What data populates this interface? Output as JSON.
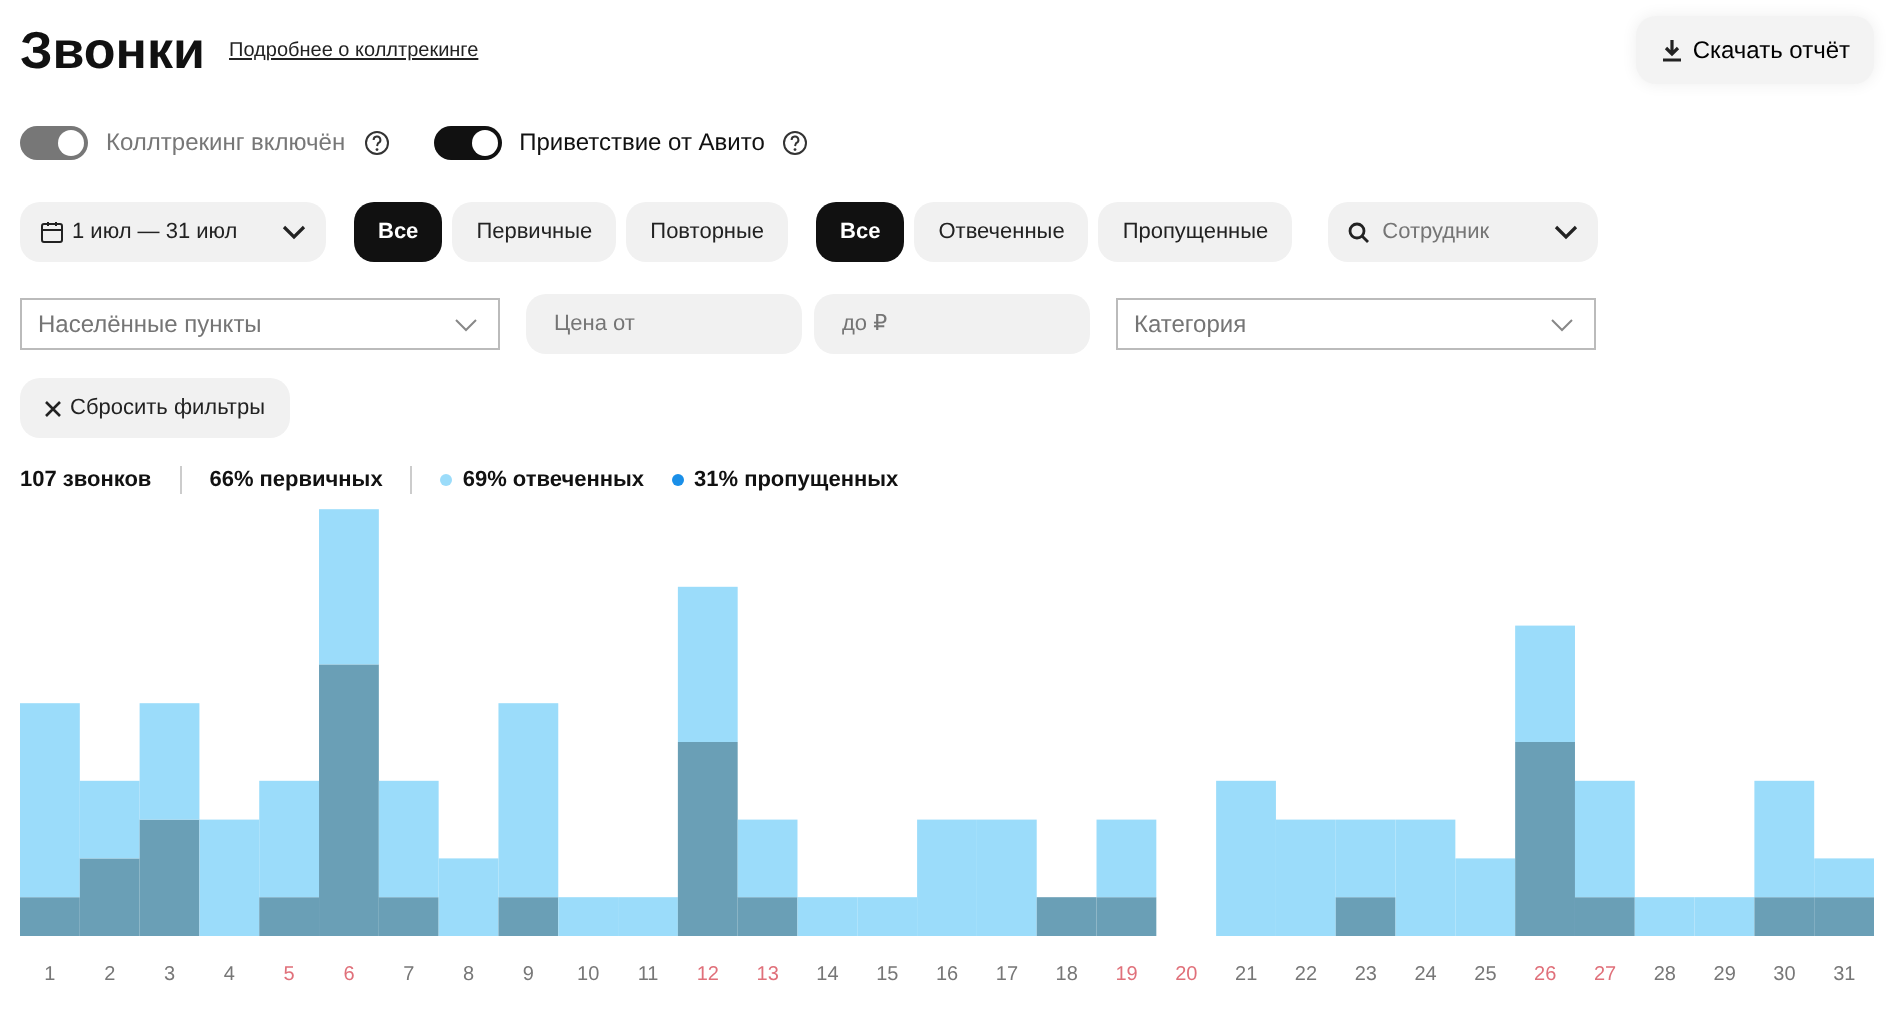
{
  "header": {
    "title": "Звонки",
    "link": "Подробнее о коллтрекинге",
    "download_button": "Скачать отчёт"
  },
  "toggles": [
    {
      "label": "Коллтрекинг включён",
      "on": true,
      "disabled": true
    },
    {
      "label": "Приветствие от Авито",
      "on": true,
      "disabled": false
    }
  ],
  "date_range": "1 июл — 31 июл",
  "segment_groups": [
    [
      {
        "label": "Все",
        "selected": true
      },
      {
        "label": "Первичные",
        "selected": false
      },
      {
        "label": "Повторные",
        "selected": false
      }
    ],
    [
      {
        "label": "Все",
        "selected": true
      },
      {
        "label": "Отвеченные",
        "selected": false
      },
      {
        "label": "Пропущенные",
        "selected": false
      }
    ]
  ],
  "employee_search": {
    "placeholder": "Сотрудник"
  },
  "filters": {
    "locations": {
      "placeholder": "Населённые пункты"
    },
    "price_from": {
      "placeholder": "Цена от"
    },
    "price_to": {
      "placeholder": "до ₽"
    },
    "category": {
      "placeholder": "Категория"
    }
  },
  "reset_button": "Сбросить фильтры",
  "stats": [
    {
      "text": "107 звонков"
    },
    {
      "text": "66% первичных"
    },
    {
      "text": "69% отвеченных",
      "color": "#9bdcfa"
    },
    {
      "text": "31% пропущенных",
      "color": "#1a8fe8"
    }
  ],
  "chart": {
    "days": [
      {
        "label": "1",
        "weekend": false
      },
      {
        "label": "2",
        "weekend": false
      },
      {
        "label": "3",
        "weekend": false
      },
      {
        "label": "4",
        "weekend": false
      },
      {
        "label": "5",
        "weekend": true
      },
      {
        "label": "6",
        "weekend": true
      },
      {
        "label": "7",
        "weekend": false
      },
      {
        "label": "8",
        "weekend": false
      },
      {
        "label": "9",
        "weekend": false
      },
      {
        "label": "10",
        "weekend": false
      },
      {
        "label": "11",
        "weekend": false
      },
      {
        "label": "12",
        "weekend": true
      },
      {
        "label": "13",
        "weekend": true
      },
      {
        "label": "14",
        "weekend": false
      },
      {
        "label": "15",
        "weekend": false
      },
      {
        "label": "16",
        "weekend": false
      },
      {
        "label": "17",
        "weekend": false
      },
      {
        "label": "18",
        "weekend": false
      },
      {
        "label": "19",
        "weekend": true
      },
      {
        "label": "20",
        "weekend": true
      },
      {
        "label": "21",
        "weekend": false
      },
      {
        "label": "22",
        "weekend": false
      },
      {
        "label": "23",
        "weekend": false
      },
      {
        "label": "24",
        "weekend": false
      },
      {
        "label": "25",
        "weekend": false
      },
      {
        "label": "26",
        "weekend": true
      },
      {
        "label": "27",
        "weekend": true
      },
      {
        "label": "28",
        "weekend": false
      },
      {
        "label": "29",
        "weekend": false
      },
      {
        "label": "30",
        "weekend": false
      },
      {
        "label": "31",
        "weekend": false
      }
    ]
  }
}
